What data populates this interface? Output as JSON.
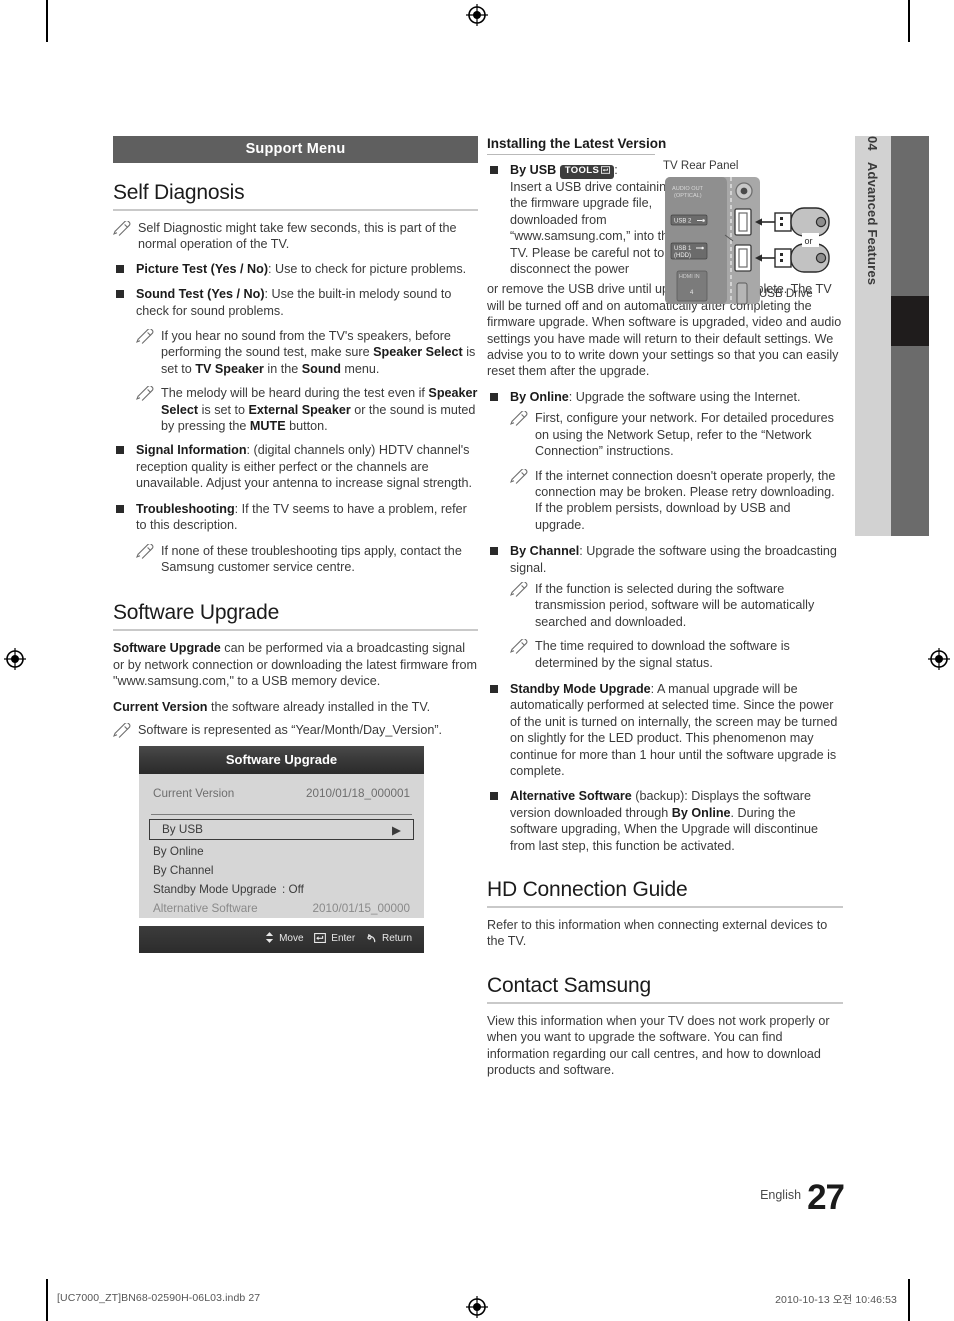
{
  "document": {
    "page_number": "27",
    "language_label": "English",
    "side_tab_number": "04",
    "side_tab_label": "Advanced Features"
  },
  "left_column": {
    "section_bar": "Support Menu",
    "self_diagnosis": {
      "heading": "Self Diagnosis",
      "note_intro": "Self Diagnostic might take few seconds, this is part of the normal operation of the TV.",
      "items": [
        {
          "label": "Picture Test (Yes / No)",
          "text": ": Use to check for picture problems."
        },
        {
          "label": "Sound Test (Yes / No)",
          "text": ": Use the built-in melody sound to check for sound problems."
        },
        {
          "label": "Signal Information",
          "text": ": (digital channels only) HDTV channel's reception quality is either perfect or the channels are unavailable. Adjust your antenna to increase signal strength."
        },
        {
          "label": "Troubleshooting",
          "text": ": If the TV seems to have a problem, refer to this description."
        }
      ],
      "sound_test_notes": [
        "If you hear no sound from the TV's speakers, before performing the sound test, make sure Speaker Select is set to TV Speaker in the Sound menu.",
        "The melody will be heard during the test even if Speaker Select is set to External Speaker or the sound is muted by pressing the MUTE button."
      ],
      "troubleshooting_note": "If none of these troubleshooting tips apply, contact the Samsung customer service centre."
    },
    "software_upgrade": {
      "heading": "Software Upgrade",
      "paragraph1_bold": "Software Upgrade",
      "paragraph1": " can be performed via a broadcasting signal or by network connection or downloading the latest firmware from \"www.samsung.com,\" to a USB memory device.",
      "paragraph2_bold": "Current Version",
      "paragraph2": " the software already installed in the TV.",
      "note": "Software is represented as “Year/Month/Day_Version”."
    },
    "osd": {
      "title": "Software Upgrade",
      "current_version_label": "Current Version",
      "current_version_value": "2010/01/18_000001",
      "rows": [
        {
          "label": "By USB",
          "value": "",
          "selected": true,
          "arrow": "▶",
          "dim": false
        },
        {
          "label": "By Online",
          "value": "",
          "selected": false,
          "arrow": "",
          "dim": false
        },
        {
          "label": "By Channel",
          "value": "",
          "selected": false,
          "arrow": "",
          "dim": false
        },
        {
          "label": "Standby Mode Upgrade",
          "value": ": Off",
          "selected": false,
          "arrow": "",
          "dim": false
        },
        {
          "label": "Alternative Software",
          "value": "2010/01/15_00000",
          "selected": false,
          "arrow": "",
          "dim": true
        }
      ],
      "footer": {
        "move": "Move",
        "enter": "Enter",
        "return": "Return"
      }
    }
  },
  "right_column": {
    "installing_heading": "Installing the Latest Version",
    "by_usb": {
      "label": "By USB",
      "badge": "TOOLS",
      "colon": ":",
      "text": "Insert a USB drive containing the firmware upgrade file, downloaded from “www.samsung.com,” into the TV. Please be careful not to disconnect the power",
      "text_continued": "or remove the USB drive until upgrades are complete. The TV will be turned off and on automatically after completing the firmware upgrade. When software is upgraded, video and audio settings you have made will return to their default settings. We advise you to to write down your settings so that you can easily reset them after the upgrade."
    },
    "usb_figure": {
      "caption": "TV Rear Panel",
      "drive_label": "USB Drive",
      "or_label": "or",
      "port_labels": [
        "AUDIO OUT (OPTICAL)",
        "USB 2",
        "USB 1 (HDD)",
        "HDMI IN",
        "4"
      ]
    },
    "by_online": {
      "label": "By Online",
      "text": ": Upgrade the software using the Internet.",
      "notes": [
        "First, configure your network. For detailed procedures on using the Network Setup, refer to the “Network Connection” instructions.",
        "If the internet connection doesn't operate properly, the connection may be broken. Please retry downloading. If the problem persists, download by USB and upgrade."
      ]
    },
    "by_channel": {
      "label": "By Channel",
      "text": ": Upgrade the software using the broadcasting signal.",
      "notes": [
        "If the function is selected during the software transmission period, software will be automatically searched and downloaded.",
        "The time required to download the software is determined by the signal status."
      ]
    },
    "standby_mode_upgrade": {
      "label": "Standby Mode Upgrade",
      "text": ": A manual upgrade will be automatically performed at selected time. Since the power of the unit is turned on internally, the screen may be turned on slightly for the LED product. This phenomenon may continue for more than 1 hour until the software upgrade is complete."
    },
    "alternative_software": {
      "label": "Alternative Software",
      "text_part1": " (backup): Displays the software version downloaded through ",
      "text_bold2": "By Online",
      "text_part2": ". During the software upgrading, When the Upgrade will discontinue from last step, this function be activated."
    },
    "hd_connection_guide": {
      "heading": "HD Connection Guide",
      "text": "Refer to this information when connecting external devices to the TV."
    },
    "contact_samsung": {
      "heading": "Contact Samsung",
      "text": "View this information when your TV does not work properly or when you want to upgrade the software. You can find information regarding our call centres, and how to download products and software."
    }
  },
  "print_footer": {
    "left": "[UC7000_ZT]BN68-02590H-06L03.indb   27",
    "right": "2010-10-13   오전 10:46:53"
  }
}
